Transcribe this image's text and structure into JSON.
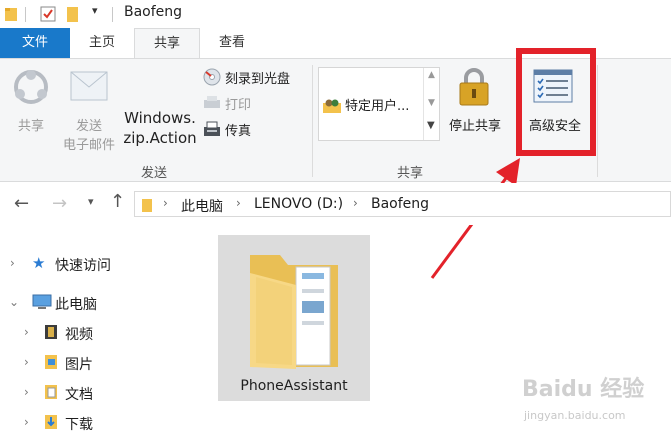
{
  "window": {
    "title": "Baofeng"
  },
  "ribbon_tabs": [
    {
      "label": "文件"
    },
    {
      "label": "主页"
    },
    {
      "label": "共享"
    },
    {
      "label": "查看"
    }
  ],
  "ribbon": {
    "share_label": "共享",
    "email_label_1": "发送",
    "email_label_2": "电子邮件",
    "zip_label_1": "Windows.",
    "zip_label_2": "zip.Action",
    "burn_label": "刻录到光盘",
    "print_label": "打印",
    "fax_label": "传真",
    "send_group": "发送",
    "specific_users": "特定用户...",
    "stop_sharing": "停止共享",
    "advanced_security": "高级安全",
    "share_group": "共享"
  },
  "address": {
    "crumbs": [
      "此电脑",
      "LENOVO (D:)",
      "Baofeng"
    ]
  },
  "nav": {
    "quick_access": "快速访问",
    "this_pc": "此电脑",
    "videos": "视频",
    "pictures": "图片",
    "documents": "文档",
    "downloads": "下载"
  },
  "content": {
    "folder_name": "PhoneAssistant"
  },
  "watermark": {
    "brand": "Baidu 经验",
    "url": "jingyan.baidu.com"
  },
  "colors": {
    "accent": "#1979ca",
    "highlight": "#e3222a",
    "folder": "#f3d27a"
  }
}
